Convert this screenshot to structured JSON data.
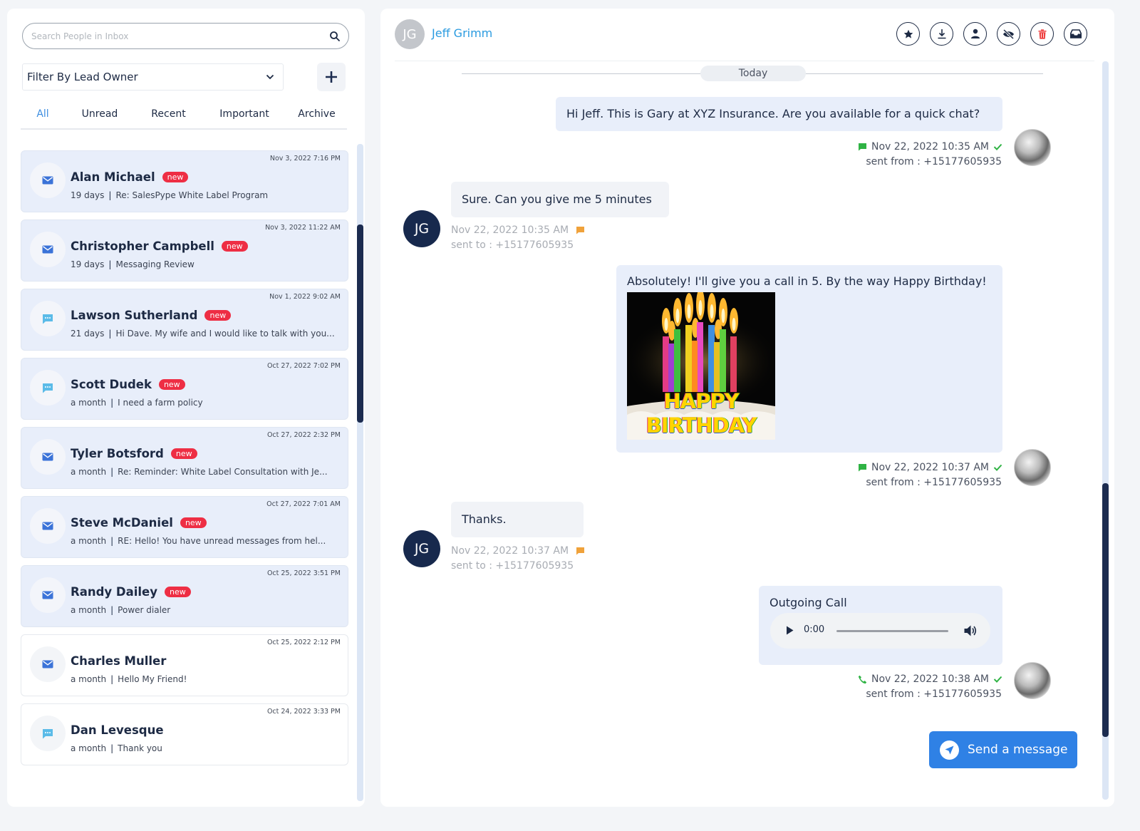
{
  "inbox": {
    "search_placeholder": "Search People in Inbox",
    "filter_label": "Filter By Lead Owner",
    "tabs": [
      "All",
      "Unread",
      "Recent",
      "Important",
      "Archive"
    ],
    "active_tab": "All",
    "conversations": [
      {
        "name": "Alan Michael",
        "badge": "new",
        "date": "Nov 3, 2022 7:16 PM",
        "age": "19 days",
        "preview": "Re: SalesPype White Label Program",
        "icon": "envelope-icon",
        "unread": true
      },
      {
        "name": "Christopher Campbell",
        "badge": "new",
        "date": "Nov 3, 2022 11:22 AM",
        "age": "19 days",
        "preview": "Messaging Review",
        "icon": "envelope-icon",
        "unread": true
      },
      {
        "name": "Lawson Sutherland",
        "badge": "new",
        "date": "Nov 1, 2022 9:02 AM",
        "age": "21 days",
        "preview": "Hi Dave. My wife and I would like to talk with you...",
        "icon": "sms-icon",
        "unread": true
      },
      {
        "name": "Scott Dudek",
        "badge": "new",
        "date": "Oct 27, 2022 7:02 PM",
        "age": "a month",
        "preview": "I need a farm policy",
        "icon": "sms-icon",
        "unread": true
      },
      {
        "name": "Tyler Botsford",
        "badge": "new",
        "date": "Oct 27, 2022 2:32 PM",
        "age": "a month",
        "preview": "Re: Reminder: White Label Consultation with Je...",
        "icon": "envelope-icon",
        "unread": true
      },
      {
        "name": "Steve McDaniel",
        "badge": "new",
        "date": "Oct 27, 2022 7:01 AM",
        "age": "a month",
        "preview": "RE: Hello! You have unread messages from hel...",
        "icon": "envelope-icon",
        "unread": true
      },
      {
        "name": "Randy Dailey",
        "badge": "new",
        "date": "Oct 25, 2022 3:51 PM",
        "age": "a month",
        "preview": "Power dialer",
        "icon": "envelope-icon",
        "unread": true
      },
      {
        "name": "Charles Muller",
        "badge": "",
        "date": "Oct 25, 2022 2:12 PM",
        "age": "a month",
        "preview": "Hello My Friend!",
        "icon": "envelope-icon",
        "unread": false
      },
      {
        "name": "Dan Levesque",
        "badge": "",
        "date": "Oct 24, 2022 3:33 PM",
        "age": "a month",
        "preview": "Thank you",
        "icon": "sms-icon",
        "unread": false
      }
    ]
  },
  "chat": {
    "contact_initials": "JG",
    "contact_name": "Jeff Grimm",
    "actions": [
      "star-icon",
      "download-icon",
      "user-icon",
      "hide-icon",
      "trash-icon",
      "inbox-icon"
    ],
    "day_label": "Today",
    "messages": [
      {
        "dir": "out",
        "text": "Hi Jeff. This is Gary at XYZ Insurance. Are you available for a quick chat?",
        "time": "Nov 22, 2022 10:35 AM",
        "route": "sent from : +15177605935"
      },
      {
        "dir": "in",
        "text": "Sure. Can you give me 5 minutes",
        "time": "Nov 22, 2022 10:35 AM",
        "route": "sent to : +15177605935"
      },
      {
        "dir": "out",
        "text": "Absolutely! I'll give you a call in 5. By the way Happy Birthday!",
        "image_caption": "HAPPY BIRTHDAY",
        "time": "Nov 22, 2022 10:37 AM",
        "route": "sent from : +15177605935"
      },
      {
        "dir": "in",
        "text": "Thanks.",
        "time": "Nov 22, 2022 10:37 AM",
        "route": "sent to : +15177605935"
      },
      {
        "dir": "out",
        "text": "Outgoing Call",
        "audio_time": "0:00",
        "time": "Nov 22, 2022 10:38 AM",
        "route": "sent from : +15177605935"
      }
    ],
    "send_label": "Send a message"
  },
  "colors": {
    "accent": "#2f81e5",
    "badge_red": "#ee2e44",
    "sms_green": "#2fb344",
    "incoming_orange": "#f0a23b",
    "navy": "#17294d"
  }
}
